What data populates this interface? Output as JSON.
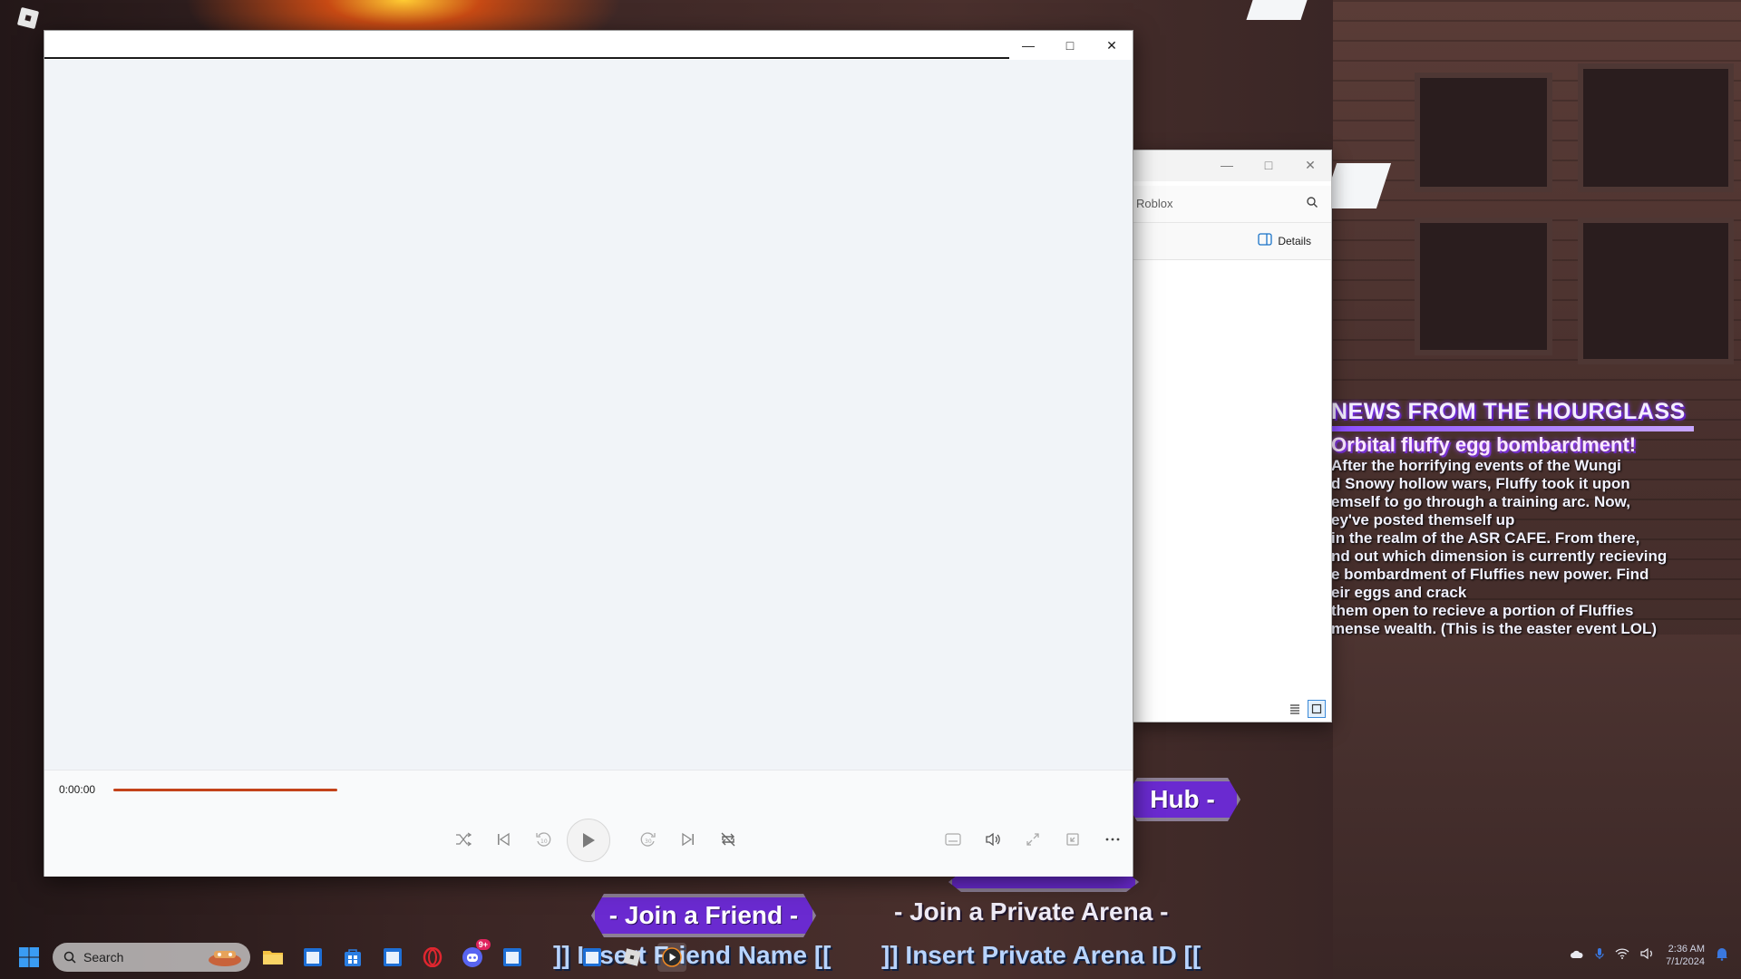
{
  "game": {
    "news_title": "NEWS FROM THE HOURGLASS",
    "news_subtitle": "Orbital fluffy egg bombardment!",
    "news_body": "After the horrifying events of the Wungi\nd Snowy hollow wars, Fluffy took it upon\nemself to go through a training arc. Now,\ney've posted themself up\nin the realm of the ASR CAFE. From there,\nnd out which dimension is currently recieving\ne bombardment of Fluffies new power. Find\neir eggs and crack\nthem open to recieve a portion of Fluffies\nmense wealth. (This is the easter event LOL)",
    "hub_label": "Hub -",
    "join_friend_label": "- Join a Friend -",
    "join_private_label": "- Join a Private Arena -",
    "friend_input_text": "]] Insert Friend Name [[",
    "private_input_text": "]] Insert Private Arena ID [["
  },
  "player": {
    "time_elapsed": "0:00:00",
    "progress": 0.0,
    "controls": [
      "shuffle-icon",
      "previous-icon",
      "rewind-10-icon",
      "play-icon",
      "forward-30-icon",
      "next-icon",
      "repeat-icon",
      "captions-icon",
      "volume-icon",
      "fullscreen-icon",
      "miniplayer-icon",
      "more-icon"
    ],
    "accent_color": "#c4421a"
  },
  "explorer": {
    "search_placeholder": "Roblox",
    "details_label": "Details"
  },
  "taskbar": {
    "search_label": "Search",
    "clock_time": "2:36 AM",
    "clock_date": "7/1/2024",
    "discord_badge": "9+"
  }
}
